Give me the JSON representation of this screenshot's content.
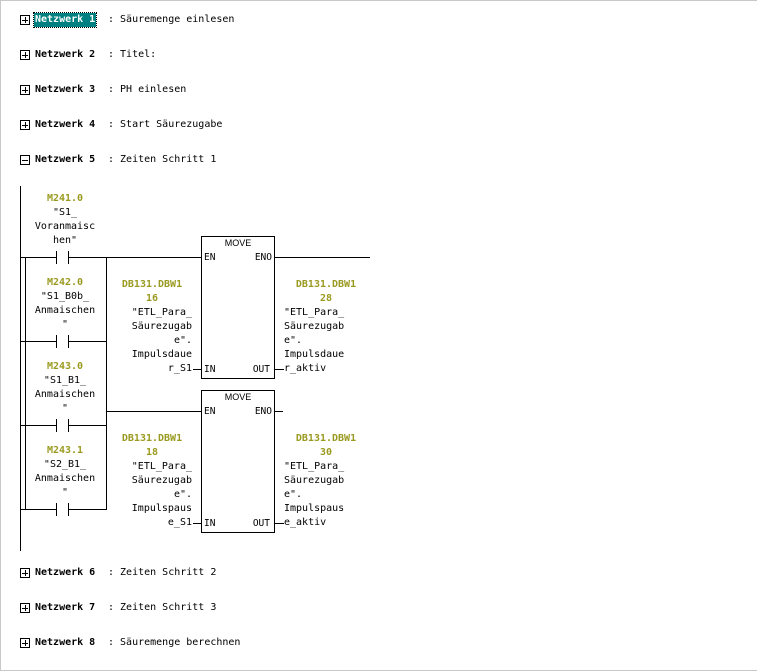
{
  "networks": [
    {
      "label": "Netzwerk 1",
      "title": ": Säuremenge einlesen",
      "expanded": false,
      "selected": true
    },
    {
      "label": "Netzwerk 2",
      "title": ": Titel:",
      "expanded": false
    },
    {
      "label": "Netzwerk 3",
      "title": ": PH einlesen",
      "expanded": false
    },
    {
      "label": "Netzwerk 4",
      "title": ": Start Säurezugabe",
      "expanded": false
    },
    {
      "label": "Netzwerk 5",
      "title": ": Zeiten Schritt 1",
      "expanded": true
    },
    {
      "label": "Netzwerk 6",
      "title": ": Zeiten Schritt 2",
      "expanded": false
    },
    {
      "label": "Netzwerk 7",
      "title": ": Zeiten Schritt 3",
      "expanded": false
    },
    {
      "label": "Netzwerk 8",
      "title": ": Säuremenge berechnen",
      "expanded": false
    }
  ],
  "contacts": [
    {
      "address": "M241.0",
      "lines": [
        "\"S1_",
        "Voranmaisc",
        "hen\""
      ]
    },
    {
      "address": "M242.0",
      "lines": [
        "\"S1_B0b_",
        "Anmaischen",
        "\""
      ]
    },
    {
      "address": "M243.0",
      "lines": [
        "\"S1_B1_",
        "Anmaischen",
        "\""
      ]
    },
    {
      "address": "M243.1",
      "lines": [
        "\"S2_B1_",
        "Anmaischen",
        "\""
      ]
    }
  ],
  "blocks": [
    {
      "name": "MOVE",
      "pins": {
        "en": "EN",
        "eno": "ENO",
        "in": "IN",
        "out": "OUT"
      },
      "in_param": {
        "address": [
          "DB131.DBW1",
          "16"
        ],
        "lines": [
          "\"ETL_Para_",
          "Säurezugab",
          "e\".",
          "Impulsdaue",
          "r_S1"
        ]
      },
      "out_param": {
        "address": [
          "DB131.DBW1",
          "28"
        ],
        "lines": [
          "\"ETL_Para_",
          "Säurezugab",
          "e\".",
          "Impulsdaue",
          "r_aktiv"
        ]
      }
    },
    {
      "name": "MOVE",
      "pins": {
        "en": "EN",
        "eno": "ENO",
        "in": "IN",
        "out": "OUT"
      },
      "in_param": {
        "address": [
          "DB131.DBW1",
          "18"
        ],
        "lines": [
          "\"ETL_Para_",
          "Säurezugab",
          "e\".",
          "Impulspaus",
          "e_S1"
        ]
      },
      "out_param": {
        "address": [
          "DB131.DBW1",
          "30"
        ],
        "lines": [
          "\"ETL_Para_",
          "Säurezugab",
          "e\".",
          "Impulspaus",
          "e_aktiv"
        ]
      }
    }
  ]
}
